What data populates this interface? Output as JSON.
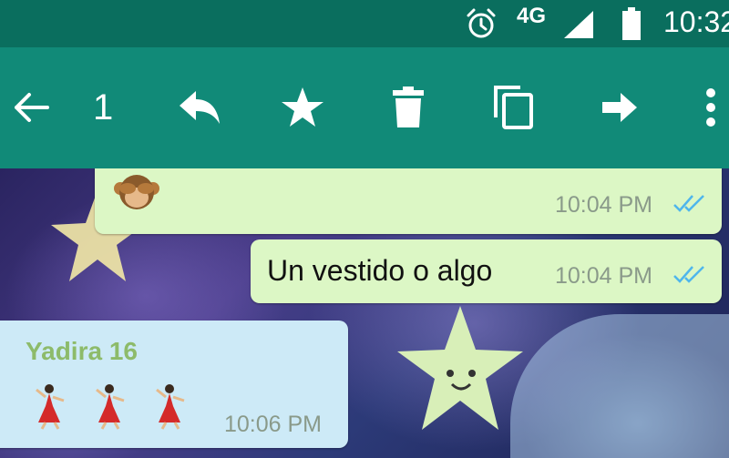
{
  "status_bar": {
    "network": "4G",
    "time": "10:32",
    "icons": [
      "alarm-icon",
      "signal-icon",
      "battery-icon"
    ]
  },
  "action_bar": {
    "selected_count": "1",
    "icons": [
      "back-arrow-icon",
      "reply-icon",
      "star-icon",
      "delete-icon",
      "copy-icon",
      "forward-icon",
      "more-vert-icon"
    ]
  },
  "messages": [
    {
      "direction": "outgoing",
      "content": "emoji-see-no-evil-monkey",
      "time": "10:04 PM",
      "status": "read"
    },
    {
      "direction": "outgoing",
      "text": "Un vestido o algo",
      "time": "10:04 PM",
      "status": "read"
    },
    {
      "direction": "incoming",
      "sender": "Yadira 16",
      "content": "emoji-dancer-x3",
      "time": "10:06 PM"
    }
  ],
  "colors": {
    "status_bar": "#0a6e5e",
    "action_bar": "#118a78",
    "outgoing_bubble": "#dcf7c5",
    "incoming_bubble": "#cdeaf7",
    "read_ticks": "#4fb6ec",
    "sender_name": "#8dbb6a"
  }
}
